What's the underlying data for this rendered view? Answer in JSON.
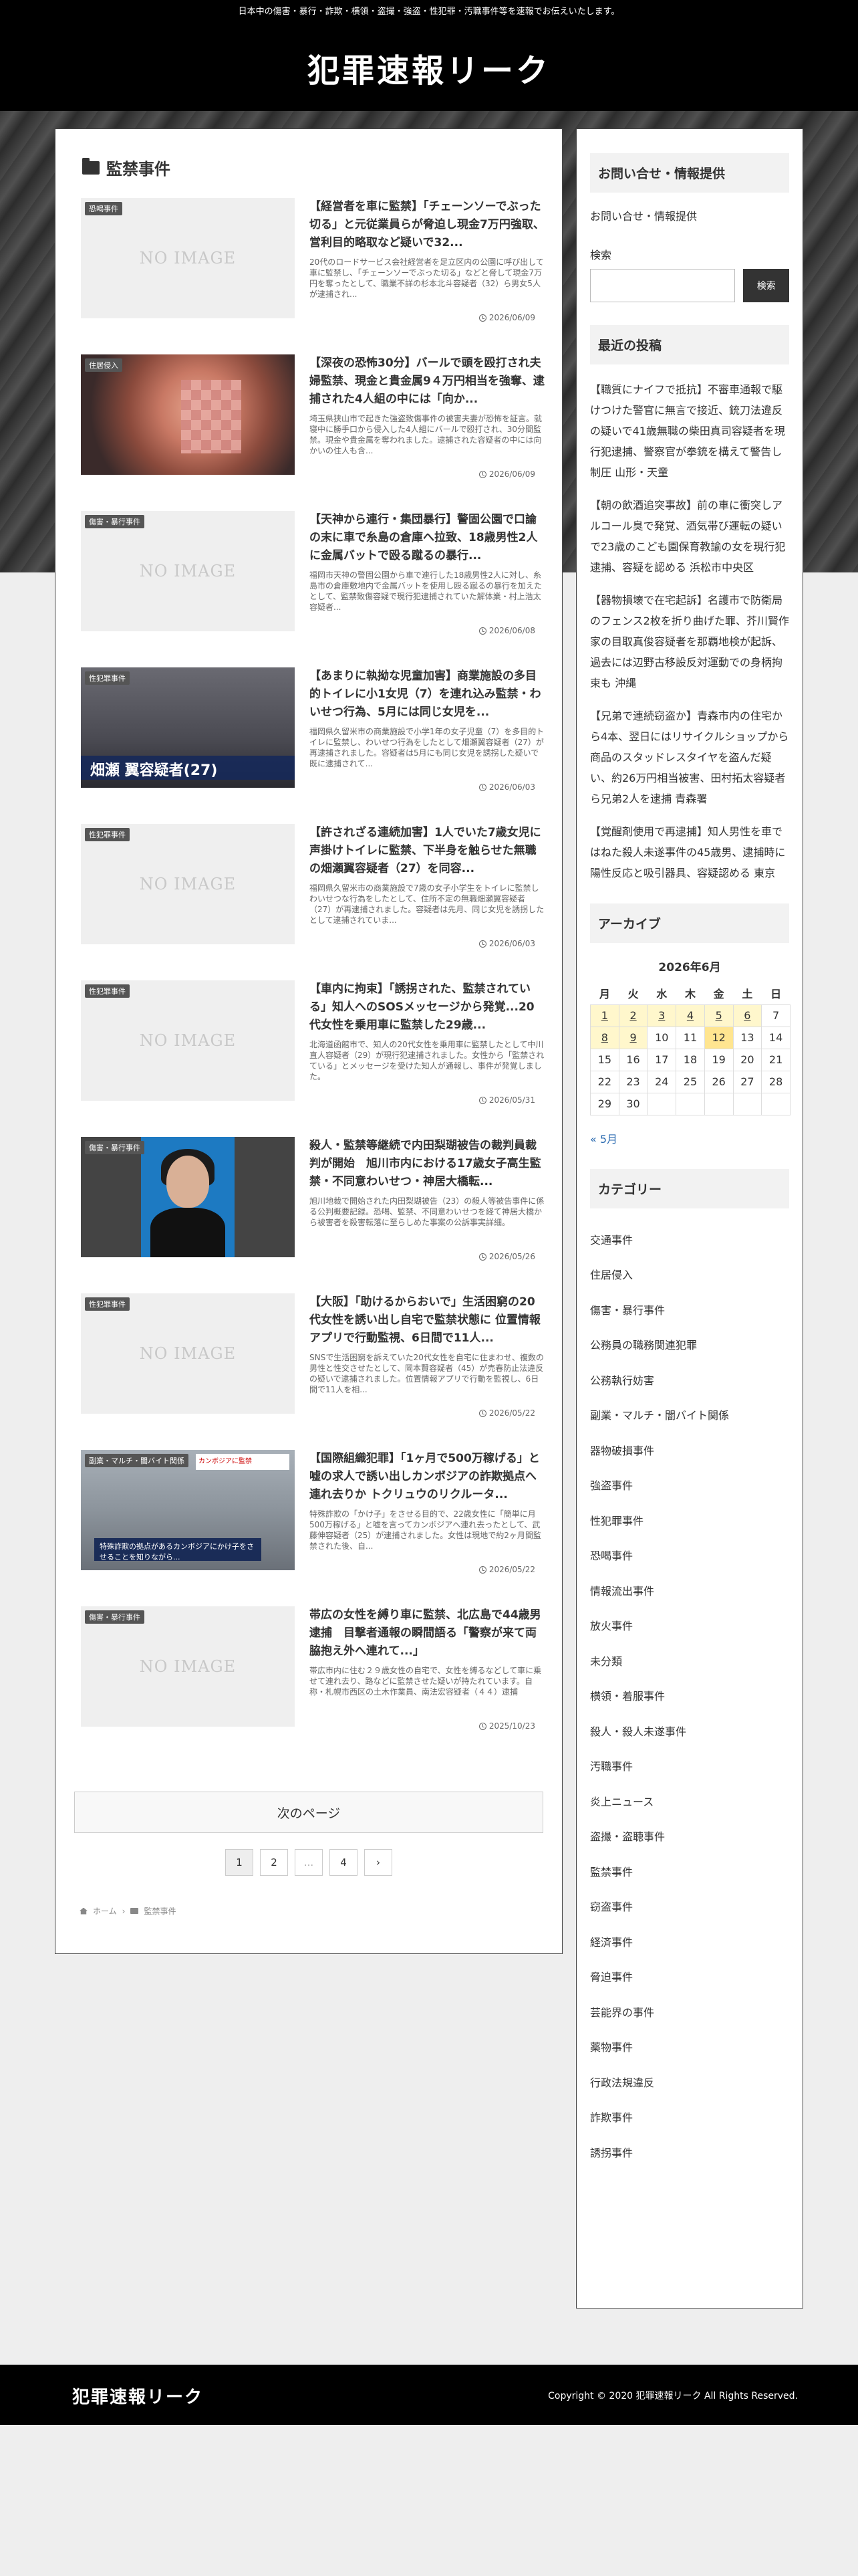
{
  "topbar_text": "日本中の傷害・暴行・詐欺・横領・盗撮・強盗・性犯罪・汚職事件等を速報でお伝えいたします。",
  "site_logo": "犯罪速報リーク",
  "section_title": "監禁事件",
  "no_image_text": "NO IMAGE",
  "posts": [
    {
      "category": "恐喝事件",
      "thumb": "noimage",
      "title": "【経営者を車に監禁】「チェーンソーでぶった切る」と元従業員らが脅迫し現金7万円強取、営利目的略取など疑いで32...",
      "excerpt": "20代のロードサービス会社経営者を足立区内の公園に呼び出して車に監禁し、「チェーンソーでぶった切る」などと脅して現金7万円を奪ったとして、職業不詳の杉本北斗容疑者（32）ら男女5人が逮捕され...",
      "date": "2026/06/09"
    },
    {
      "category": "住居侵入",
      "thumb": "face",
      "title": "【深夜の恐怖30分】バールで頭を殴打され夫婦監禁、現金と貴金属9４万円相当を強奪、逮捕された4人組の中には「向か...",
      "excerpt": "埼玉県狭山市で起きた強盗致傷事件の被害夫妻が恐怖を証言。就寝中に勝手口から侵入した4人組にバールで殴打され、30分間監禁。現金や貴金属を奪われました。逮捕された容疑者の中には向かいの住人も含...",
      "date": "2026/06/09"
    },
    {
      "category": "傷害・暴行事件",
      "thumb": "noimage",
      "title": "【天神から連行・集団暴行】警固公園で口論の末に車で糸島の倉庫へ拉致、18歳男性2人に金属バットで殴る蹴るの暴行...",
      "excerpt": "福岡市天神の警固公園から車で連行した18歳男性2人に対し、糸島市の倉庫敷地内で金属バットを使用し殴る蹴るの暴行を加えたとして、監禁致傷容疑で現行犯逮捕されていた解体業・村上浩太容疑者...",
      "date": "2026/06/08"
    },
    {
      "category": "性犯罪事件",
      "thumb": "news",
      "band": "畑瀬 翼容疑者(27)",
      "title": "【あまりに執拗な児童加害】商業施設の多目的トイレに小1女児（7）を連れ込み監禁・わいせつ行為、5月には同じ女児を...",
      "excerpt": "福岡県久留米市の商業施設で小学1年の女子児童（7）を多目的トイレに監禁し、わいせつ行為をしたとして畑瀬翼容疑者（27）が再逮捕されました。容疑者は5月にも同じ女児を誘拐した疑いで既に逮捕されて...",
      "date": "2026/06/03"
    },
    {
      "category": "性犯罪事件",
      "thumb": "noimage",
      "title": "【許されざる連続加害】1人でいた7歳女児に声掛けトイレに監禁、下半身を触らせた無職の畑瀬翼容疑者（27）を同容...",
      "excerpt": "福岡県久留米市の商業施設で7歳の女子小学生をトイレに監禁しわいせつな行為をしたとして、住所不定の無職畑瀬翼容疑者（27）が再逮捕されました。容疑者は先月、同じ女児を誘拐したとして逮捕されていま...",
      "date": "2026/06/03"
    },
    {
      "category": "性犯罪事件",
      "thumb": "noimage",
      "title": "【車内に拘束】「誘拐された、監禁されている」知人へのSOSメッセージから発覚...20代女性を乗用車に監禁した29歳...",
      "excerpt": "北海道函館市で、知人の20代女性を乗用車に監禁したとして中川直人容疑者（29）が現行犯逮捕されました。女性から「監禁されている」とメッセージを受けた知人が通報し、事件が発覚しました。",
      "date": "2026/05/31"
    },
    {
      "category": "傷害・暴行事件",
      "thumb": "portrait",
      "title": "殺人・監禁等継続で内田梨瑚被告の裁判員裁判が開始　旭川市内における17歳女子高生監禁・不同意わいせつ・神居大橋転...",
      "excerpt": "旭川地裁で開始された内田梨瑚被告（23）の殺人等被告事件に係る公判概要記録。恐喝、監禁、不同意わいせつを経て神居大橋から被害者を殺害転落に至らしめた事案の公訴事実詳細。",
      "date": "2026/05/26"
    },
    {
      "category": "性犯罪事件",
      "thumb": "noimage",
      "title": "【大阪】「助けるからおいで」生活困窮の20代女性を誘い出し自宅で監禁状態に 位置情報アプリで行動監視、6日間で11人...",
      "excerpt": "SNSで生活困窮を訴えていた20代女性を自宅に住まわせ、複数の男性と性交させたとして、岡本賢容疑者（45）が売春防止法違反の疑いで逮捕されました。位置情報アプリで行動を監視し、6日間で11人を相...",
      "date": "2026/05/22"
    },
    {
      "category": "副業・マルチ・闇バイト関係",
      "thumb": "group",
      "band": "特殊詐欺の拠点があるカンボジアにかけ子をさせることを知りながら...",
      "tag": "カンボジアに監禁",
      "title": "【国際組織犯罪】「1ヶ月で500万稼げる」と嘘の求人で誘い出しカンボジアの詐欺拠点へ連れ去りか トクリュウのリクルータ...",
      "excerpt": "特殊詐欺の「かけ子」をさせる目的で、22歳女性に「簡単に月500万稼げる」と嘘を言ってカンボジアへ連れ去ったとして、武藤伸容疑者（25）が逮捕されました。女性は現地で約2ヶ月間監禁された後、自...",
      "date": "2026/05/22"
    },
    {
      "category": "傷害・暴行事件",
      "thumb": "noimage",
      "title": "帯広の女性を縛り車に監禁、北広島で44歳男逮捕　目撃者通報の瞬間語る「警察が来て両脇抱え外へ連れて...」",
      "excerpt": "帯広市内に住む２９歳女性の自宅で、女性を縛るなどして車に乗せて連れ去り、路などに監禁させた疑いが持たれています。自称・札幌市西区の土木作業員、南法宏容疑者（４４）逮捕",
      "date": "2025/10/23"
    }
  ],
  "pagination": {
    "next_label": "次のページ",
    "pages": [
      "1",
      "2",
      "...",
      "4",
      "›"
    ]
  },
  "breadcrumb": {
    "home": "ホーム",
    "current": "監禁事件"
  },
  "sidebar": {
    "contact_title": "お問い合せ・情報提供",
    "contact_link": "お問い合せ・情報提供",
    "search_label": "検索",
    "search_button": "検索",
    "recent_title": "最近の投稿",
    "recent_posts": [
      "【職質にナイフで抵抗】不審車通報で駆けつけた警官に無言で接近、銃刀法違反の疑いで41歳無職の柴田真司容疑者を現行犯逮捕、警察官が拳銃を構えて警告し制圧 山形・天童",
      "【朝の飲酒追突事故】前の車に衝突しアルコール臭で発覚、酒気帯び運転の疑いで23歳のこども園保育教諭の女を現行犯逮捕、容疑を認める 浜松市中央区",
      "【器物損壊で在宅起訴】名護市で防衛局のフェンス2枚を折り曲げた罪、芥川賢作家の目取真俊容疑者を那覇地検が起訴、過去には辺野古移設反対運動での身柄拘束も 沖縄",
      "【兄弟で連続窃盗か】青森市内の住宅から4本、翌日にはリサイクルショップから商品のスタッドレスタイヤを盗んだ疑い、約26万円相当被害、田村拓太容疑者ら兄弟2人を逮捕 青森署",
      "【覚醒剤使用で再逮捕】知人男性を車ではねた殺人未遂事件の45歳男、逮捕時に陽性反応と吸引器具、容疑認める 東京"
    ],
    "archive_title": "アーカイブ",
    "calendar": {
      "caption": "2026年6月",
      "weekdays": [
        "月",
        "火",
        "水",
        "木",
        "金",
        "土",
        "日"
      ],
      "weeks": [
        [
          "1",
          "2",
          "3",
          "4",
          "5",
          "6",
          "7"
        ],
        [
          "8",
          "9",
          "10",
          "11",
          "12",
          "13",
          "14"
        ],
        [
          "15",
          "16",
          "17",
          "18",
          "19",
          "20",
          "21"
        ],
        [
          "22",
          "23",
          "24",
          "25",
          "26",
          "27",
          "28"
        ],
        [
          "29",
          "30",
          "",
          "",
          "",
          "",
          ""
        ]
      ],
      "post_days": [
        "1",
        "2",
        "3",
        "4",
        "5",
        "6",
        "8",
        "9"
      ],
      "today": "12",
      "prev_link": "« 5月"
    },
    "category_title": "カテゴリー",
    "categories": [
      "交通事件",
      "住居侵入",
      "傷害・暴行事件",
      "公務員の職務関連犯罪",
      "公務執行妨害",
      "副業・マルチ・闇バイト関係",
      "器物破損事件",
      "強盗事件",
      "性犯罪事件",
      "恐喝事件",
      "情報流出事件",
      "放火事件",
      "未分類",
      "横領・着服事件",
      "殺人・殺人未遂事件",
      "汚職事件",
      "炎上ニュース",
      "盗撮・盗聴事件",
      "監禁事件",
      "窃盗事件",
      "経済事件",
      "脅迫事件",
      "芸能界の事件",
      "薬物事件",
      "行政法規違反",
      "詐欺事件",
      "誘拐事件"
    ]
  },
  "footer": {
    "logo": "犯罪速報リーク",
    "copyright": "Copyright © 2020 犯罪速報リーク All Rights Reserved."
  }
}
